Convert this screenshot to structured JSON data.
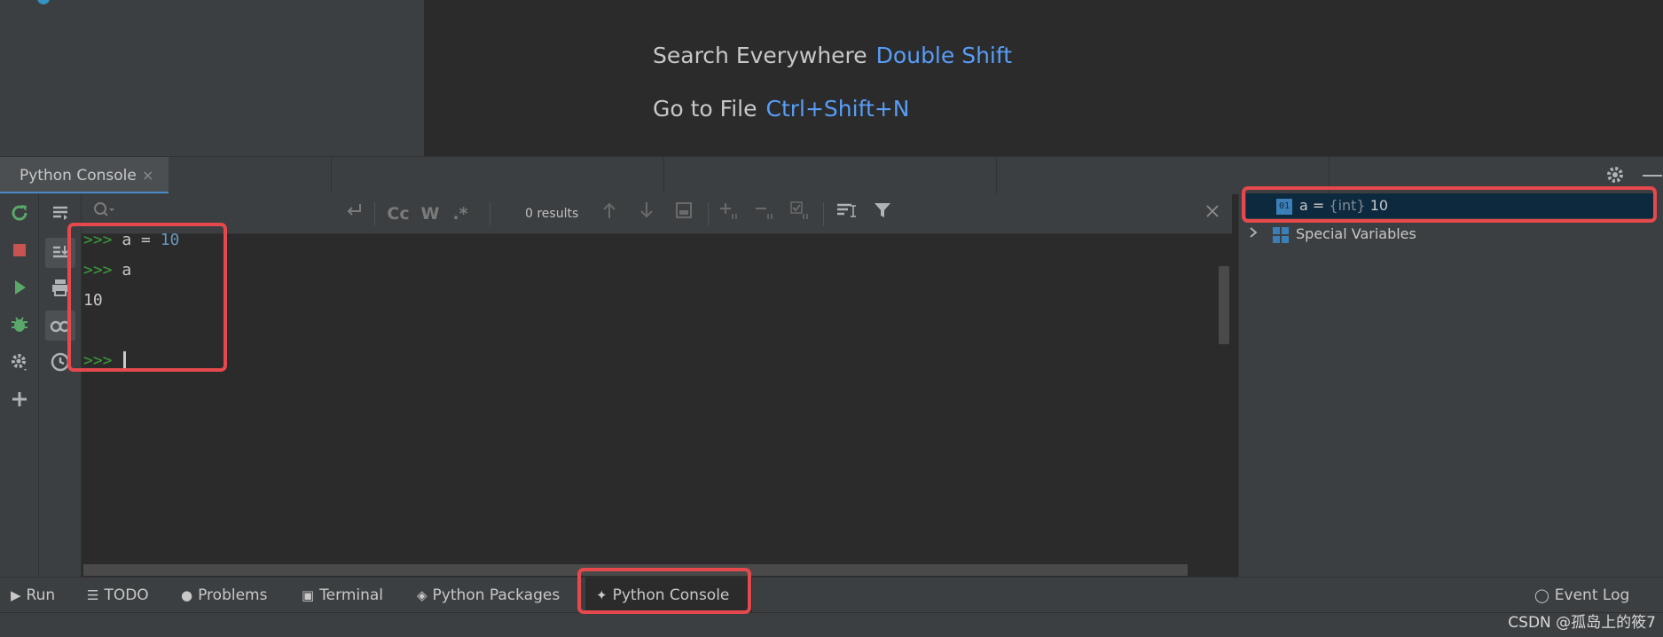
{
  "editor_hints": [
    {
      "label": "Search Everywhere",
      "key": "Double Shift"
    },
    {
      "label": "Go to File",
      "key": "Ctrl+Shift+N"
    }
  ],
  "tool_window": {
    "tab_label": "Python Console",
    "close": "×"
  },
  "find_bar": {
    "case_label": "Cc",
    "word_label": "W",
    "regex_label": ".*",
    "results": "0 results"
  },
  "console": {
    "lines": [
      {
        "prompt": ">>>",
        "code": "a = ",
        "number": "10"
      },
      {
        "prompt": ">>>",
        "code": "a",
        "number": ""
      },
      {
        "prompt": "",
        "code": "10",
        "number": ""
      },
      {
        "prompt": ">>>",
        "code": "",
        "number": ""
      }
    ]
  },
  "variables": {
    "items": [
      {
        "badge": "01",
        "name": "a = ",
        "type": "{int}",
        "value": " 10"
      },
      {
        "name": "Special Variables"
      }
    ]
  },
  "bottom_tabs": [
    {
      "icon": "run-icon",
      "label": "Run"
    },
    {
      "icon": "todo-icon",
      "label": "TODO"
    },
    {
      "icon": "problems-icon",
      "label": "Problems"
    },
    {
      "icon": "terminal-icon",
      "label": "Terminal"
    },
    {
      "icon": "python-packages-icon",
      "label": "Python Packages"
    },
    {
      "icon": "python-console-icon",
      "label": "Python Console"
    }
  ],
  "event_log": "Event Log",
  "watermark": "CSDN @孤岛上的筱7",
  "colors": {
    "accent": "#4a88c7",
    "highlight_box": "#e5484d",
    "prompt": "#3a9b3a",
    "number": "#6897bb"
  }
}
